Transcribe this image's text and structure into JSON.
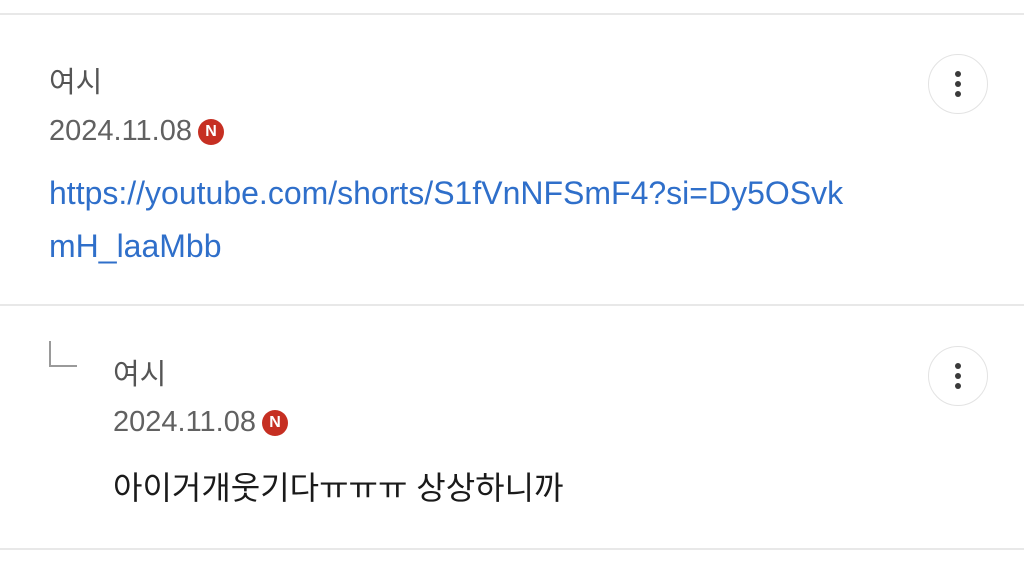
{
  "comments": [
    {
      "author": "여시",
      "date": "2024.11.08",
      "badge": "N",
      "body_link": "https://youtube.com/shorts/S1fVnNFSmF4?si=Dy5OSvkmH_laaMbb",
      "more_icon": "more-vertical-icon"
    },
    {
      "author": "여시",
      "date": "2024.11.08",
      "badge": "N",
      "body": "아이거개웃기다ㅠㅠㅠ 상상하니까",
      "is_reply": true,
      "reply_icon": "reply-arrow-icon",
      "more_icon": "more-vertical-icon"
    }
  ],
  "colors": {
    "link": "#2f6fca",
    "badge": "#c62f22",
    "divider": "#e8e8e8"
  }
}
